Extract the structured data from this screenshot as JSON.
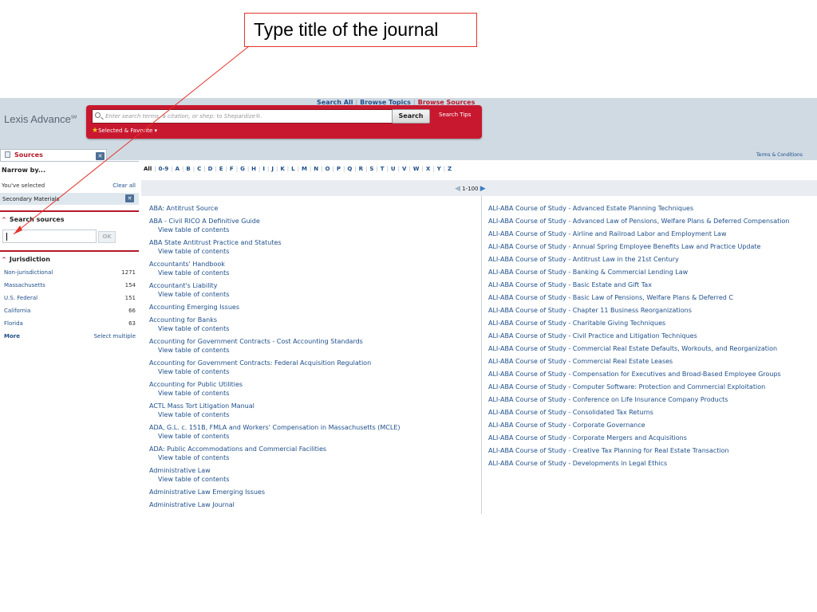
{
  "callout": {
    "text": "Type title of the journal"
  },
  "header": {
    "nav": [
      "Search All",
      "Browse Topics",
      "Browse Sources"
    ],
    "active_nav": "Browse Sources",
    "logo": "Lexis Advance",
    "logo_mark": "SM",
    "search_placeholder": "Enter search terms, a citation, or shep: to Shepardize®.",
    "search_button": "Search",
    "search_tips": "Search Tips",
    "favorites": "Selected & Favorite ▾",
    "terms": "Terms & Conditions"
  },
  "sidebar": {
    "tab": "Sources",
    "narrow_title": "Narrow by...",
    "youve_selected": "You've selected",
    "clear_all": "Clear all",
    "selected_filter": "Secondary Materials",
    "search_sources_title": "Search sources",
    "ok_button": "OK",
    "jurisdiction_title": "Jurisdiction",
    "jurisdictions": [
      {
        "name": "Non-jurisdictional",
        "count": "1271"
      },
      {
        "name": "Massachusetts",
        "count": "154"
      },
      {
        "name": "U.S. Federal",
        "count": "151"
      },
      {
        "name": "California",
        "count": "66"
      },
      {
        "name": "Florida",
        "count": "63"
      }
    ],
    "more": "More",
    "select_multiple": "Select multiple"
  },
  "alphabet": [
    "All",
    "0-9",
    "A",
    "B",
    "C",
    "D",
    "E",
    "F",
    "G",
    "H",
    "I",
    "J",
    "K",
    "L",
    "M",
    "N",
    "O",
    "P",
    "Q",
    "R",
    "S",
    "T",
    "U",
    "V",
    "W",
    "X",
    "Y",
    "Z"
  ],
  "active_letter": "All",
  "pager": {
    "range": "1-100"
  },
  "toc_label": "View table of contents",
  "sources_left": [
    {
      "title": "ABA: Antitrust Source",
      "toc": false
    },
    {
      "title": "ABA - Civil RICO A Definitive Guide",
      "toc": true
    },
    {
      "title": "ABA State Antitrust Practice and Statutes",
      "toc": true
    },
    {
      "title": "Accountants' Handbook",
      "toc": true
    },
    {
      "title": "Accountant's Liability",
      "toc": true
    },
    {
      "title": "Accounting Emerging Issues",
      "toc": false
    },
    {
      "title": "Accounting for Banks",
      "toc": true
    },
    {
      "title": "Accounting for Government Contracts - Cost Accounting Standards",
      "toc": true
    },
    {
      "title": "Accounting for Government Contracts: Federal Acquisition Regulation",
      "toc": true
    },
    {
      "title": "Accounting for Public Utilities",
      "toc": true
    },
    {
      "title": "ACTL Mass Tort Litigation Manual",
      "toc": true
    },
    {
      "title": "ADA, G.L. c. 151B, FMLA and Workers' Compensation in Massachusetts (MCLE)",
      "toc": true
    },
    {
      "title": "ADA: Public Accommodations and Commercial Facilities",
      "toc": true
    },
    {
      "title": "Administrative Law",
      "toc": true
    },
    {
      "title": "Administrative Law Emerging Issues",
      "toc": false
    },
    {
      "title": "Administrative Law Journal",
      "toc": false
    }
  ],
  "sources_right": [
    "ALI-ABA Course of Study - Advanced Estate Planning Techniques",
    "ALI-ABA Course of Study - Advanced Law of Pensions, Welfare Plans & Deferred Compensation",
    "ALI-ABA Course of Study - Airline and Railroad Labor and Employment Law",
    "ALI-ABA Course of Study - Annual Spring Employee Benefits Law and Practice Update",
    "ALI-ABA Course of Study - Antitrust Law in the 21st Century",
    "ALI-ABA Course of Study - Banking & Commercial Lending Law",
    "ALI-ABA Course of Study - Basic Estate and Gift Tax",
    "ALI-ABA Course of Study - Basic Law of Pensions, Welfare Plans & Deferred C",
    "ALI-ABA Course of Study - Chapter 11 Business Reorganizations",
    "ALI-ABA Course of Study - Charitable Giving Techniques",
    "ALI-ABA Course of Study - Civil Practice and Litigation Techniques",
    "ALI-ABA Course of Study - Commercial Real Estate Defaults, Workouts, and Reorganization",
    "ALI-ABA Course of Study - Commercial Real Estate Leases",
    "ALI-ABA Course of Study - Compensation for Executives and Broad-Based Employee Groups",
    "ALI-ABA Course of Study - Computer Software: Protection and Commercial Exploitation",
    "ALI-ABA Course of Study - Conference on Life Insurance Company Products",
    "ALI-ABA Course of Study - Consolidated Tax Returns",
    "ALI-ABA Course of Study - Corporate Governance",
    "ALI-ABA Course of Study - Corporate Mergers and Acquisitions",
    "ALI-ABA Course of Study - Creative Tax Planning for Real Estate Transaction",
    "ALI-ABA Course of Study - Developments in Legal Ethics"
  ]
}
